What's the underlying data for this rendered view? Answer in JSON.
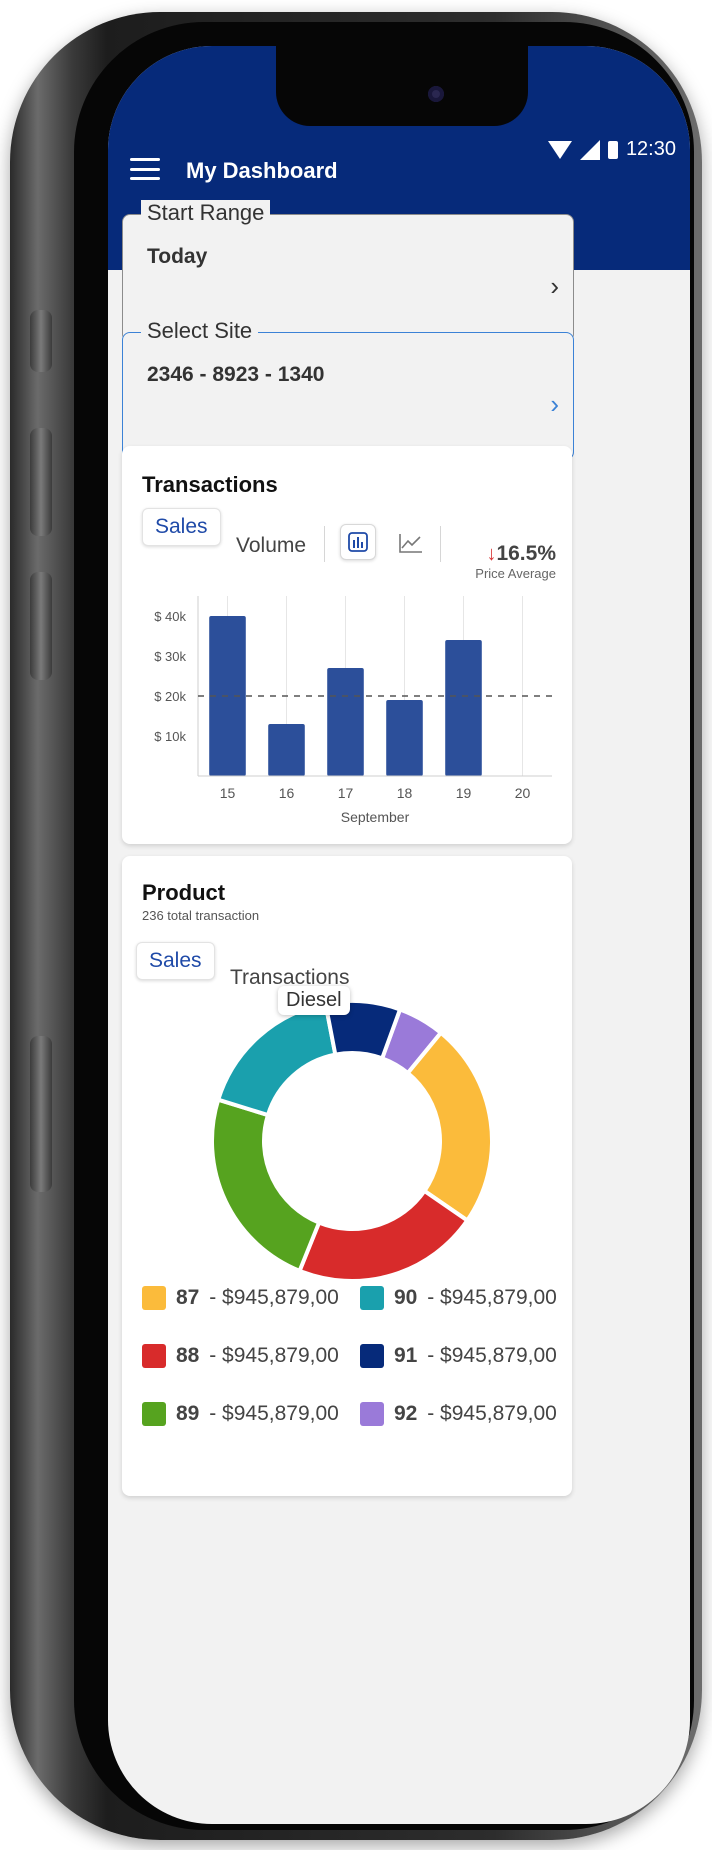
{
  "app": {
    "title": "My Dashboard",
    "time": "12:30"
  },
  "filters": {
    "start_range": {
      "label": "Start Range",
      "value": "Today"
    },
    "site": {
      "label": "Select Site",
      "value": "2346 - 8923 - 1340"
    }
  },
  "transactions": {
    "title": "Transactions",
    "tabs": [
      "Sales",
      "Volume"
    ],
    "price_change": {
      "value": "16.5%",
      "label": "Price Average",
      "direction": "down"
    }
  },
  "product": {
    "title": "Product",
    "subtitle": "236 total transaction",
    "tabs": [
      "Sales",
      "Transactions"
    ],
    "tooltip": "Diesel",
    "legend": [
      {
        "code": "87",
        "amount": "$945,879,00",
        "color": "#fbbb3b"
      },
      {
        "code": "90",
        "amount": "$945,879,00",
        "color": "#1aa0ad"
      },
      {
        "code": "88",
        "amount": "$945,879,00",
        "color": "#d82b2b"
      },
      {
        "code": "91",
        "amount": "$945,879,00",
        "color": "#062a7a"
      },
      {
        "code": "89",
        "amount": "$945,879,00",
        "color": "#56a31f"
      },
      {
        "code": "92",
        "amount": "$945,879,00",
        "color": "#9a7ad9"
      }
    ]
  },
  "chart_data": [
    {
      "type": "bar",
      "categories": [
        "15",
        "16",
        "17",
        "18",
        "19",
        "20"
      ],
      "values": [
        40000,
        13000,
        27000,
        19000,
        34000,
        0
      ],
      "reference_line": 20000,
      "xlabel": "September",
      "ylabel": "",
      "yticks": [
        "$ 10k",
        "$ 20k",
        "$ 30k",
        "$ 40k"
      ],
      "ylim": [
        0,
        45000
      ],
      "color": "#2c4f9a"
    },
    {
      "type": "pie",
      "donut": true,
      "categories": [
        "87",
        "88",
        "89",
        "90",
        "91",
        "92"
      ],
      "values": [
        22,
        20,
        22,
        16,
        8,
        5
      ]
    }
  ]
}
